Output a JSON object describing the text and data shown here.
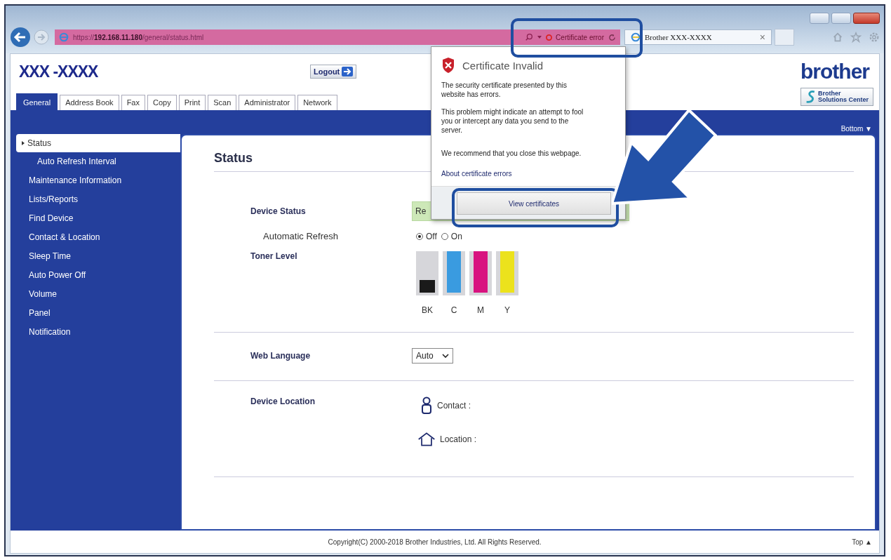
{
  "browser": {
    "url": {
      "scheme": "https://",
      "host": "192.168.11.180",
      "path": "/general/status.html"
    },
    "cert_error": "Certificate error",
    "tabs": [
      {
        "title": "Brother  XXX-XXXX",
        "close": "×",
        "selected": true
      }
    ]
  },
  "header": {
    "model": "XXX -XXXX",
    "logout": "Logout",
    "brand": "brother",
    "solutions": [
      "Brother",
      "Solutions Center"
    ]
  },
  "nav_tabs": [
    {
      "label": "General",
      "selected": true
    },
    {
      "label": "Address Book",
      "selected": false
    },
    {
      "label": "Fax",
      "selected": false
    },
    {
      "label": "Copy",
      "selected": false
    },
    {
      "label": "Print",
      "selected": false
    },
    {
      "label": "Scan",
      "selected": false
    },
    {
      "label": "Administrator",
      "selected": false
    },
    {
      "label": "Network",
      "selected": false
    }
  ],
  "bottom_link": "Bottom ▼",
  "sidebar": {
    "items": [
      {
        "label": "Status",
        "selected": true,
        "children": [
          {
            "label": "Auto Refresh Interval",
            "selected": false
          }
        ]
      },
      {
        "label": "Maintenance Information",
        "selected": false
      },
      {
        "label": "Lists/Reports",
        "selected": false
      },
      {
        "label": "Find Device",
        "selected": false
      },
      {
        "label": "Contact & Location",
        "selected": false
      },
      {
        "label": "Sleep Time",
        "selected": false
      },
      {
        "label": "Auto Power Off",
        "selected": false
      },
      {
        "label": "Volume",
        "selected": false
      },
      {
        "label": "Panel",
        "selected": false
      },
      {
        "label": "Notification",
        "selected": false
      }
    ]
  },
  "status": {
    "title": "Status",
    "device_status": {
      "label": "Device Status",
      "value": "Re"
    },
    "auto_refresh": {
      "label": "Automatic Refresh",
      "options": [
        {
          "label": "Off",
          "selected": true
        },
        {
          "label": "On",
          "selected": false
        }
      ]
    },
    "toner": {
      "label": "Toner Level",
      "cartridges": [
        {
          "label": "BK",
          "color": "#1a1a1a",
          "low": true
        },
        {
          "label": "C",
          "color": "#3a9be0",
          "low": false
        },
        {
          "label": "M",
          "color": "#d8137f",
          "low": false
        },
        {
          "label": "Y",
          "color": "#ece21c",
          "low": false
        }
      ]
    },
    "web_language": {
      "label": "Web Language",
      "value": "Auto"
    },
    "device_location": {
      "label": "Device Location",
      "contact": "Contact :",
      "location": "Location :"
    }
  },
  "footer": {
    "copyright": "Copyright(C) 2000-2018 Brother Industries, Ltd. All Rights Reserved.",
    "top": "Top ▲"
  },
  "popup": {
    "title": "Certificate Invalid",
    "paragraphs": [
      "The security certificate presented by this website has errors.",
      "This problem might indicate an attempt to fool you or intercept any data you send to the server.",
      "We recommend that you close this webpage."
    ],
    "link": "About certificate errors",
    "button": "View certificates"
  }
}
